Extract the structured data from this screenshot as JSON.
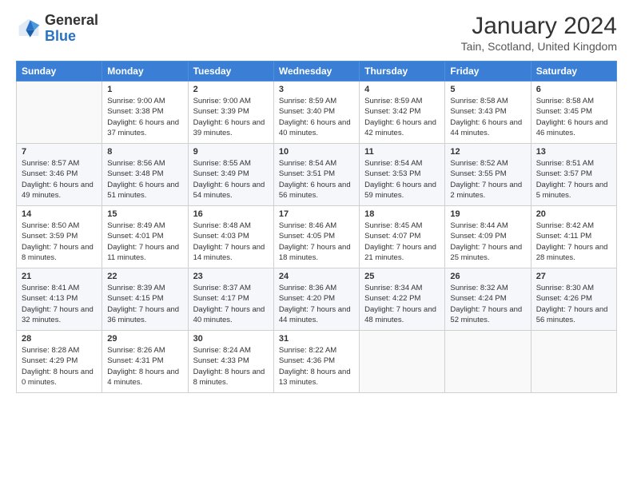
{
  "header": {
    "logo_general": "General",
    "logo_blue": "Blue",
    "title": "January 2024",
    "location": "Tain, Scotland, United Kingdom"
  },
  "days_of_week": [
    "Sunday",
    "Monday",
    "Tuesday",
    "Wednesday",
    "Thursday",
    "Friday",
    "Saturday"
  ],
  "weeks": [
    [
      {
        "day": "",
        "sunrise": "",
        "sunset": "",
        "daylight": ""
      },
      {
        "day": "1",
        "sunrise": "9:00 AM",
        "sunset": "3:38 PM",
        "daylight": "6 hours and 37 minutes."
      },
      {
        "day": "2",
        "sunrise": "9:00 AM",
        "sunset": "3:39 PM",
        "daylight": "6 hours and 39 minutes."
      },
      {
        "day": "3",
        "sunrise": "8:59 AM",
        "sunset": "3:40 PM",
        "daylight": "6 hours and 40 minutes."
      },
      {
        "day": "4",
        "sunrise": "8:59 AM",
        "sunset": "3:42 PM",
        "daylight": "6 hours and 42 minutes."
      },
      {
        "day": "5",
        "sunrise": "8:58 AM",
        "sunset": "3:43 PM",
        "daylight": "6 hours and 44 minutes."
      },
      {
        "day": "6",
        "sunrise": "8:58 AM",
        "sunset": "3:45 PM",
        "daylight": "6 hours and 46 minutes."
      }
    ],
    [
      {
        "day": "7",
        "sunrise": "8:57 AM",
        "sunset": "3:46 PM",
        "daylight": "6 hours and 49 minutes."
      },
      {
        "day": "8",
        "sunrise": "8:56 AM",
        "sunset": "3:48 PM",
        "daylight": "6 hours and 51 minutes."
      },
      {
        "day": "9",
        "sunrise": "8:55 AM",
        "sunset": "3:49 PM",
        "daylight": "6 hours and 54 minutes."
      },
      {
        "day": "10",
        "sunrise": "8:54 AM",
        "sunset": "3:51 PM",
        "daylight": "6 hours and 56 minutes."
      },
      {
        "day": "11",
        "sunrise": "8:54 AM",
        "sunset": "3:53 PM",
        "daylight": "6 hours and 59 minutes."
      },
      {
        "day": "12",
        "sunrise": "8:52 AM",
        "sunset": "3:55 PM",
        "daylight": "7 hours and 2 minutes."
      },
      {
        "day": "13",
        "sunrise": "8:51 AM",
        "sunset": "3:57 PM",
        "daylight": "7 hours and 5 minutes."
      }
    ],
    [
      {
        "day": "14",
        "sunrise": "8:50 AM",
        "sunset": "3:59 PM",
        "daylight": "7 hours and 8 minutes."
      },
      {
        "day": "15",
        "sunrise": "8:49 AM",
        "sunset": "4:01 PM",
        "daylight": "7 hours and 11 minutes."
      },
      {
        "day": "16",
        "sunrise": "8:48 AM",
        "sunset": "4:03 PM",
        "daylight": "7 hours and 14 minutes."
      },
      {
        "day": "17",
        "sunrise": "8:46 AM",
        "sunset": "4:05 PM",
        "daylight": "7 hours and 18 minutes."
      },
      {
        "day": "18",
        "sunrise": "8:45 AM",
        "sunset": "4:07 PM",
        "daylight": "7 hours and 21 minutes."
      },
      {
        "day": "19",
        "sunrise": "8:44 AM",
        "sunset": "4:09 PM",
        "daylight": "7 hours and 25 minutes."
      },
      {
        "day": "20",
        "sunrise": "8:42 AM",
        "sunset": "4:11 PM",
        "daylight": "7 hours and 28 minutes."
      }
    ],
    [
      {
        "day": "21",
        "sunrise": "8:41 AM",
        "sunset": "4:13 PM",
        "daylight": "7 hours and 32 minutes."
      },
      {
        "day": "22",
        "sunrise": "8:39 AM",
        "sunset": "4:15 PM",
        "daylight": "7 hours and 36 minutes."
      },
      {
        "day": "23",
        "sunrise": "8:37 AM",
        "sunset": "4:17 PM",
        "daylight": "7 hours and 40 minutes."
      },
      {
        "day": "24",
        "sunrise": "8:36 AM",
        "sunset": "4:20 PM",
        "daylight": "7 hours and 44 minutes."
      },
      {
        "day": "25",
        "sunrise": "8:34 AM",
        "sunset": "4:22 PM",
        "daylight": "7 hours and 48 minutes."
      },
      {
        "day": "26",
        "sunrise": "8:32 AM",
        "sunset": "4:24 PM",
        "daylight": "7 hours and 52 minutes."
      },
      {
        "day": "27",
        "sunrise": "8:30 AM",
        "sunset": "4:26 PM",
        "daylight": "7 hours and 56 minutes."
      }
    ],
    [
      {
        "day": "28",
        "sunrise": "8:28 AM",
        "sunset": "4:29 PM",
        "daylight": "8 hours and 0 minutes."
      },
      {
        "day": "29",
        "sunrise": "8:26 AM",
        "sunset": "4:31 PM",
        "daylight": "8 hours and 4 minutes."
      },
      {
        "day": "30",
        "sunrise": "8:24 AM",
        "sunset": "4:33 PM",
        "daylight": "8 hours and 8 minutes."
      },
      {
        "day": "31",
        "sunrise": "8:22 AM",
        "sunset": "4:36 PM",
        "daylight": "8 hours and 13 minutes."
      },
      {
        "day": "",
        "sunrise": "",
        "sunset": "",
        "daylight": ""
      },
      {
        "day": "",
        "sunrise": "",
        "sunset": "",
        "daylight": ""
      },
      {
        "day": "",
        "sunrise": "",
        "sunset": "",
        "daylight": ""
      }
    ]
  ],
  "labels": {
    "sunrise_prefix": "Sunrise: ",
    "sunset_prefix": "Sunset: ",
    "daylight_prefix": "Daylight: "
  }
}
